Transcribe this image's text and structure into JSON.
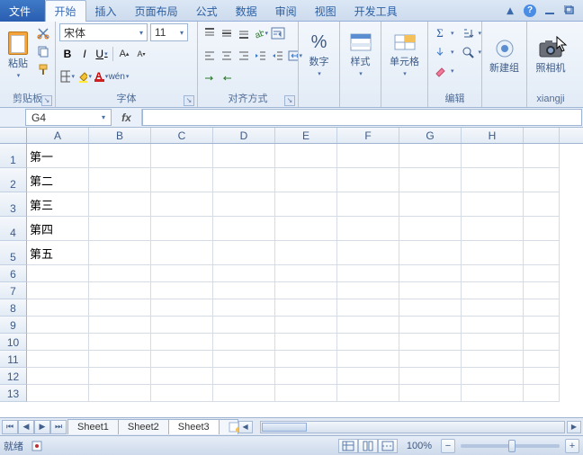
{
  "tabs": {
    "file": "文件",
    "home": "开始",
    "insert": "插入",
    "page_layout": "页面布局",
    "formulas": "公式",
    "data": "数据",
    "review": "审阅",
    "view": "视图",
    "dev": "开发工具"
  },
  "ribbon": {
    "clipboard": {
      "paste": "粘贴",
      "group": "剪贴板"
    },
    "font": {
      "name": "宋体",
      "size": "11",
      "group": "字体",
      "bold": "B",
      "italic": "I",
      "underline": "U"
    },
    "alignment": {
      "group": "对齐方式"
    },
    "number": {
      "btn": "数字",
      "percent": "%"
    },
    "styles": {
      "btn": "样式"
    },
    "cells": {
      "btn": "单元格"
    },
    "editing": {
      "group": "编辑"
    },
    "newgroup": {
      "btn": "新建组"
    },
    "camera": {
      "btn": "照相机",
      "group": "xiangji"
    }
  },
  "name_box": "G4",
  "fx": "fx",
  "columns": [
    "A",
    "B",
    "C",
    "D",
    "E",
    "F",
    "G",
    "H"
  ],
  "rows": [
    "1",
    "2",
    "3",
    "4",
    "5",
    "6",
    "7",
    "8",
    "9",
    "10",
    "11",
    "12",
    "13"
  ],
  "cells": {
    "A1": "第一",
    "A2": "第二",
    "A3": "第三",
    "A4": "第四",
    "A5": "第五"
  },
  "sheets": [
    "Sheet1",
    "Sheet2",
    "Sheet3"
  ],
  "status": {
    "ready": "就绪",
    "zoom": "100%"
  }
}
